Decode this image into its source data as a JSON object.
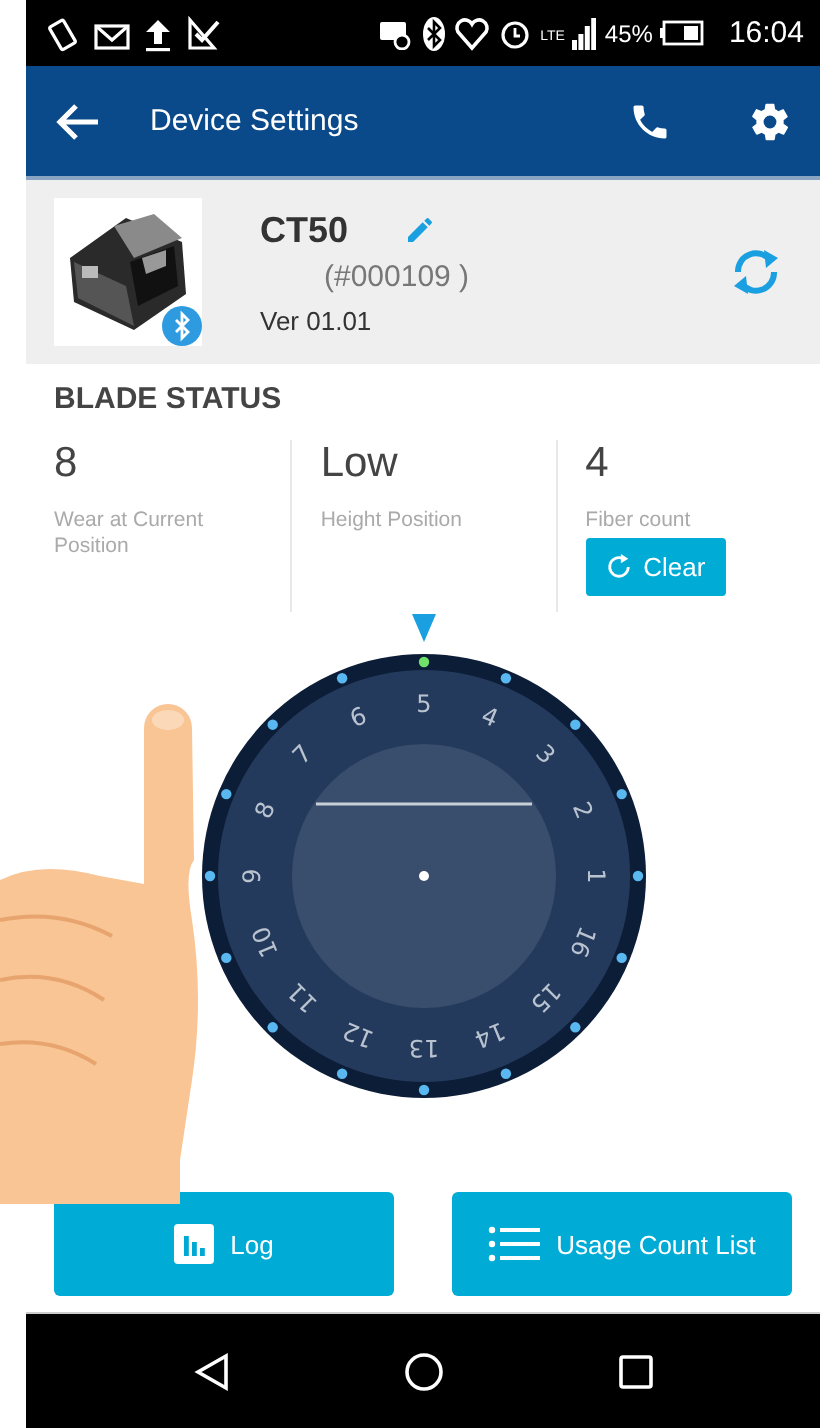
{
  "status_bar": {
    "network": "LTE",
    "battery": "45%",
    "time": "16:04"
  },
  "app_bar": {
    "title": "Device Settings"
  },
  "device": {
    "name": "CT50",
    "serial": "(#000109  )",
    "version": "Ver 01.01"
  },
  "blade_status": {
    "title": "BLADE STATUS",
    "stats": [
      {
        "value": "8",
        "label": "Wear at Current Position"
      },
      {
        "value": "Low",
        "label": "Height Position"
      },
      {
        "value": "4",
        "label": "Fiber count",
        "action": "Clear"
      }
    ]
  },
  "dial": {
    "positions": [
      {
        "label": "5",
        "selected": true
      },
      {
        "label": "4",
        "selected": false
      },
      {
        "label": "3",
        "selected": false
      },
      {
        "label": "2",
        "selected": false
      },
      {
        "label": "1",
        "selected": false
      },
      {
        "label": "16",
        "selected": false
      },
      {
        "label": "15",
        "selected": false
      },
      {
        "label": "14",
        "selected": false
      },
      {
        "label": "13",
        "selected": false
      },
      {
        "label": "12",
        "selected": false
      },
      {
        "label": "11",
        "selected": false
      },
      {
        "label": "10",
        "selected": false
      },
      {
        "label": "9",
        "selected": false
      },
      {
        "label": "8",
        "selected": false
      },
      {
        "label": "7",
        "selected": false
      },
      {
        "label": "6",
        "selected": false
      }
    ]
  },
  "buttons": [
    {
      "label": "Log",
      "kind": "log"
    },
    {
      "label": "Usage Count List",
      "kind": "list"
    }
  ]
}
